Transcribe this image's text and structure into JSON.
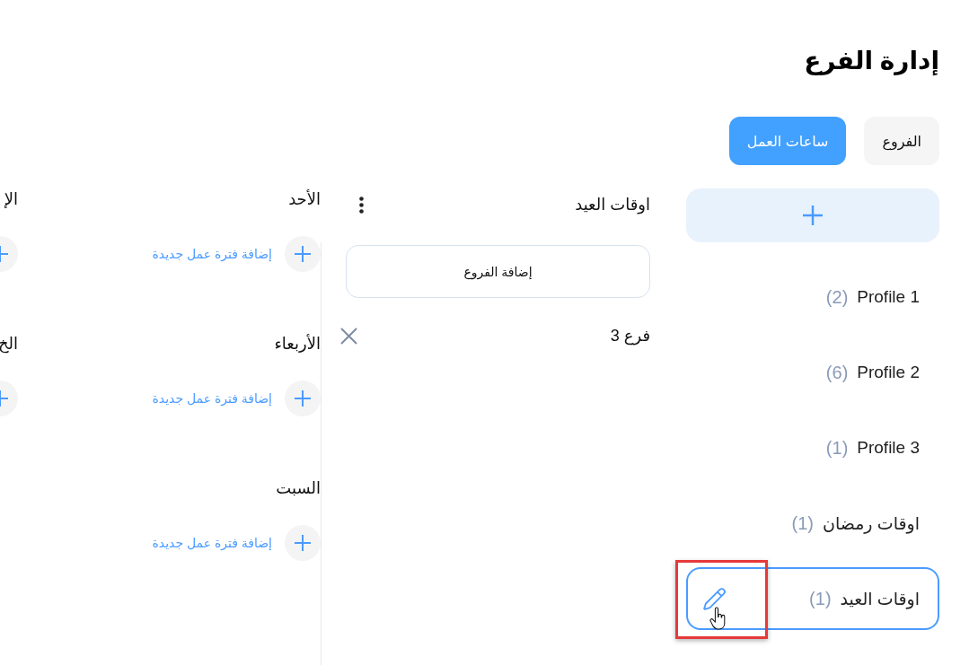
{
  "page": {
    "title": "إدارة الفرع"
  },
  "tabs": [
    {
      "label": "الفروع",
      "selected": false
    },
    {
      "label": "ساعات العمل",
      "selected": true
    }
  ],
  "sidebar": {
    "items": [
      {
        "name": "Profile 1",
        "count": "(2)",
        "selected": false,
        "hovered": false,
        "highlighted": false
      },
      {
        "name": "Profile 2",
        "count": "(6)",
        "selected": false,
        "hovered": false,
        "highlighted": false
      },
      {
        "name": "Profile 3",
        "count": "(1)",
        "selected": false,
        "hovered": false,
        "highlighted": false
      },
      {
        "name": "اوقات رمضان",
        "count": "(1)",
        "selected": false,
        "hovered": false,
        "highlighted": false
      },
      {
        "name": "اوقات العيد",
        "count": "(1)",
        "selected": true,
        "hovered": true,
        "highlighted": true
      }
    ]
  },
  "profile_panel": {
    "title": "اوقات العيد",
    "add_button": "إضافة الفروع",
    "branches": [
      {
        "name": "فرع 3"
      }
    ]
  },
  "schedule": {
    "days": [
      {
        "name": "الأحد",
        "add_label": "إضافة فترة عمل جديدة"
      },
      {
        "name": "الإ"
      },
      {
        "name": "الأربعاء",
        "add_label": "إضافة فترة عمل جديدة"
      },
      {
        "name": "الخ"
      },
      {
        "name": "السبت",
        "add_label": "إضافة فترة عمل جديدة"
      }
    ]
  }
}
